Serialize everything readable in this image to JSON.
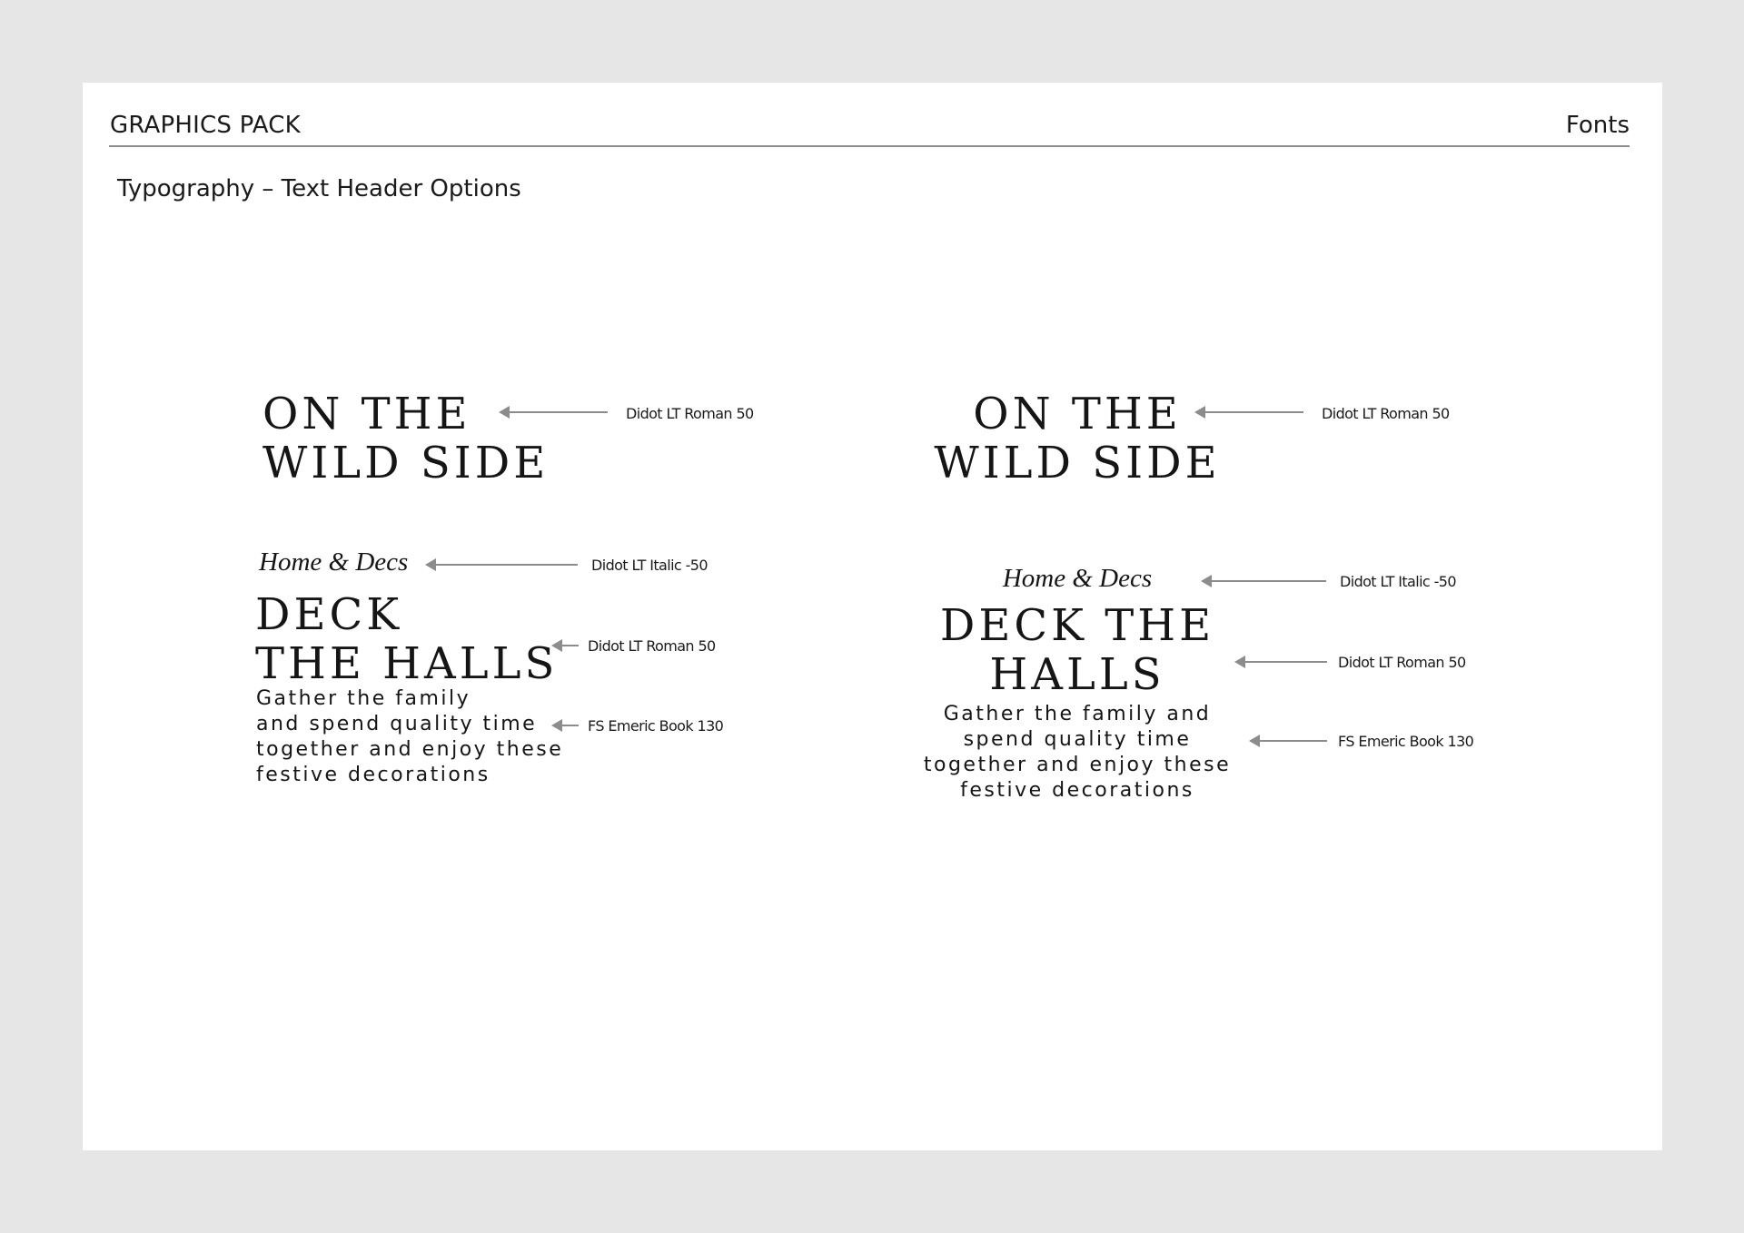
{
  "header": {
    "title": "GRAPHICS PACK",
    "section": "Fonts"
  },
  "page_title": "Typography – Text Header Options",
  "left": {
    "headline": [
      "ON THE",
      "WILD SIDE"
    ],
    "headline_note": "Didot LT Roman 50",
    "subtitle": "Home & Decs",
    "subtitle_note": "Didot LT Italic -50",
    "title": [
      "DECK",
      "THE HALLS"
    ],
    "title_note": "Didot LT Roman 50",
    "body": [
      "Gather the family",
      "and spend quality time",
      "together and enjoy these",
      "festive decorations"
    ],
    "body_note": "FS Emeric Book 130"
  },
  "right": {
    "headline": [
      "ON THE",
      "WILD SIDE"
    ],
    "headline_note": "Didot LT Roman 50",
    "subtitle": "Home & Decs",
    "subtitle_note": "Didot LT Italic -50",
    "title": [
      "DECK THE",
      "HALLS"
    ],
    "title_note": "Didot LT Roman 50",
    "body": [
      "Gather the family and",
      "spend quality time",
      "together and enjoy these",
      "festive decorations"
    ],
    "body_note": "FS Emeric Book 130"
  },
  "colors": {
    "background": "#e6e6e6",
    "page": "#ffffff",
    "text": "#151515",
    "rule": "#8c8c8c"
  }
}
